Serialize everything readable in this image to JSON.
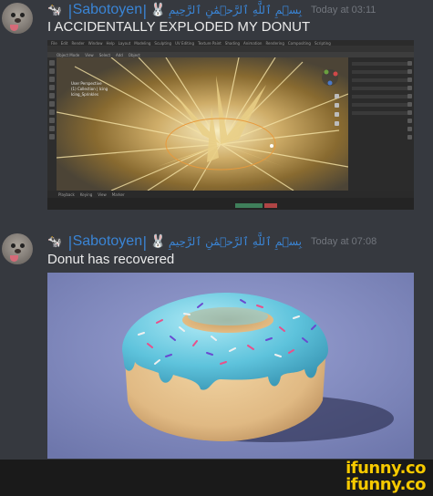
{
  "messages": [
    {
      "badge": "🐄",
      "username": "Sabotoyen",
      "rabbit": "🐰",
      "arabic": "بِسۡمِ ٱللَّهِ ٱلرَّحۡمَٰنِ ٱلرَّحِيمِ",
      "timestamp": "Today at 03:11",
      "text": "I ACCIDENTALLY EXPLODED MY DONUT"
    },
    {
      "badge": "🐄",
      "username": "Sabotoyen",
      "rabbit": "🐰",
      "arabic": "بِسۡمِ ٱللَّهِ ٱلرَّحۡمَٰنِ ٱلرَّحِيمِ",
      "timestamp": "Today at 07:08",
      "text": "Donut has recovered"
    }
  ],
  "blender": {
    "menu": [
      "File",
      "Edit",
      "Render",
      "Window",
      "Help",
      "Layout",
      "Modeling",
      "Sculpting",
      "UV Editing",
      "Texture Paint",
      "Shading",
      "Animation",
      "Rendering",
      "Compositing",
      "Scripting"
    ],
    "header": [
      "Object Mode",
      "View",
      "Select",
      "Add",
      "Object"
    ],
    "overlay": [
      "User Perspective",
      "(1) Collection | Icing",
      "Icing_Sprinkles"
    ],
    "timeline": [
      "Playback",
      "Keying",
      "View",
      "Marker"
    ]
  },
  "watermark": {
    "line1": "ifunny.co",
    "line2": "ifunny.co"
  },
  "colors": {
    "background": "#36393f",
    "username": "#3a85d6",
    "timestamp": "#72767d",
    "watermark": "#f6c900"
  }
}
